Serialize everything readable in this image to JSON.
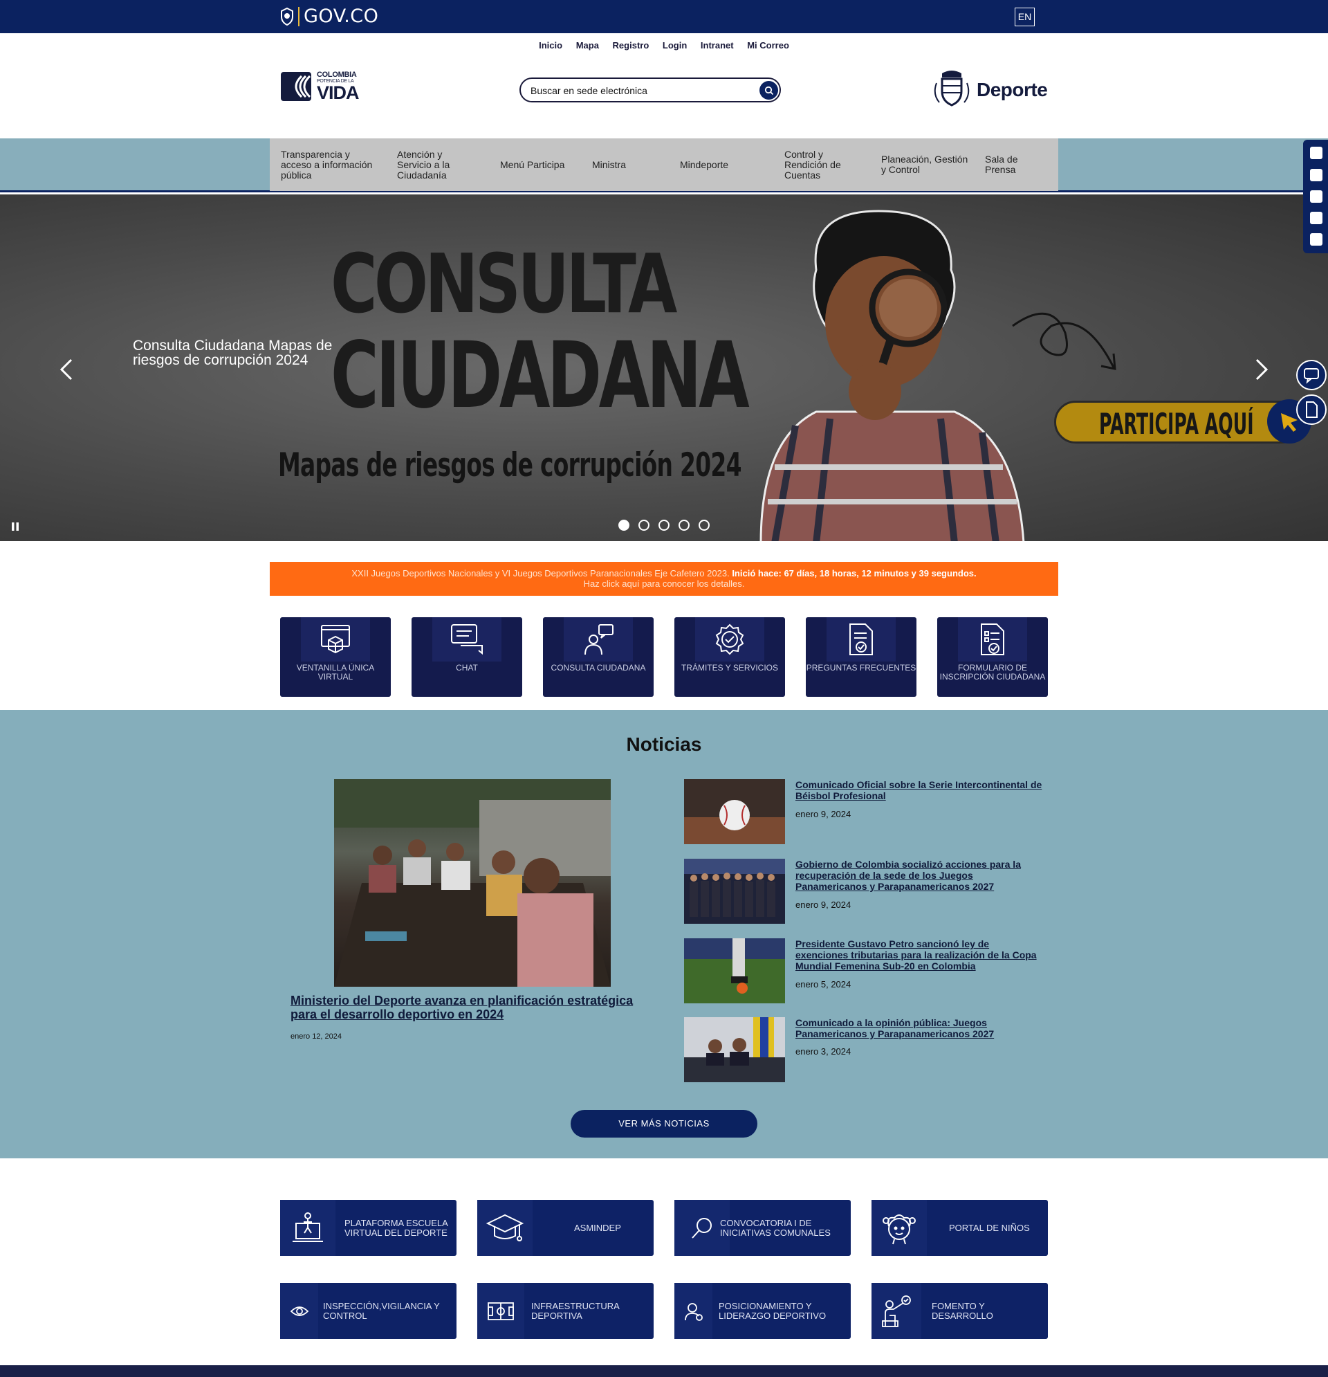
{
  "govbar": {
    "brand": "GOV.CO",
    "lang": "EN"
  },
  "utility_links": [
    "Inicio",
    "Mapa",
    "Registro",
    "Login",
    "Intranet",
    "Mi Correo"
  ],
  "header": {
    "logo": {
      "line1": "COLOMBIA",
      "line2": "POTENCIA DE LA",
      "line3": "VIDA"
    },
    "search_placeholder": "Buscar en sede electrónica",
    "ministry": "Deporte"
  },
  "nav": {
    "items": [
      "Transparencia y acceso a información pública",
      "Atención y Servicio a la Ciudadanía",
      "Menú Participa",
      "Ministra",
      "Mindeporte",
      "Control y Rendición de Cuentas",
      "Planeación, Gestión y Control",
      "Sala de Prensa"
    ]
  },
  "hero": {
    "caption": "Consulta Ciudadana Mapas de riesgos de corrupción 2024",
    "headline_1": "CONSULTA",
    "headline_2": "CIUDADANA",
    "subheadline": "Mapas de riesgos de corrupción 2024",
    "cta": "PARTICIPA AQUÍ",
    "slides_total": 5,
    "active_slide": 1
  },
  "banner": {
    "lead": "XXII Juegos Deportivos Nacionales y VI Juegos Deportivos Paranacionales Eje Cafetero 2023.",
    "countdown": "Inició hace: 67 días, 18 horas, 12 minutos y 39 segundos.",
    "line2": "Haz click aquí para conocer los detalles."
  },
  "quick_tiles": [
    {
      "label": "VENTANILLA ÚNICA VIRTUAL",
      "icon": "browser-box-icon"
    },
    {
      "label": "CHAT",
      "icon": "chat-icon"
    },
    {
      "label": "CONSULTA CIUDADANA",
      "icon": "person-chat-icon"
    },
    {
      "label": "TRÁMITES Y SERVICIOS",
      "icon": "badge-check-icon"
    },
    {
      "label": "PREGUNTAS FRECUENTES",
      "icon": "document-check-icon"
    },
    {
      "label": "FORMULARIO DE INSCRIPCIÓN CIUDADANA",
      "icon": "form-check-icon"
    }
  ],
  "news": {
    "heading": "Noticias",
    "featured": {
      "title": "Ministerio del Deporte avanza en planificación estratégica para el desarrollo deportivo en 2024",
      "date": "enero 12, 2024"
    },
    "items": [
      {
        "title": "Comunicado Oficial sobre la Serie Intercontinental de Béisbol Profesional",
        "date": "enero 9, 2024"
      },
      {
        "title": "Gobierno de Colombia socializó acciones para la recuperación de la sede de los Juegos Panamericanos y Parapanamericanos 2027",
        "date": "enero 9, 2024"
      },
      {
        "title": "Presidente Gustavo Petro sancionó ley de exenciones tributarias para la realización de la Copa Mundial Femenina Sub-20 en Colombia",
        "date": "enero 5, 2024"
      },
      {
        "title": "Comunicado a la opinión pública: Juegos Panamericanos y Parapanamericanos 2027",
        "date": "enero 3, 2024"
      }
    ],
    "more_button": "VER MÁS NOTICIAS"
  },
  "bottom_tiles": [
    {
      "label": "PLATAFORMA ESCUELA VIRTUAL DEL DEPORTE",
      "icon": "laptop-person-icon"
    },
    {
      "label": "ASMINDEP",
      "icon": "graduation-cap-icon"
    },
    {
      "label": "CONVOCATORIA I DE INICIATIVAS COMUNALES",
      "icon": "magnifier-icon"
    },
    {
      "label": "PORTAL DE NIÑOS",
      "icon": "child-face-icon"
    },
    {
      "label": "INSPECCIÓN,VIGILANCIA Y CONTROL",
      "icon": "eye-icon"
    },
    {
      "label": "INFRAESTRUCTURA DEPORTIVA",
      "icon": "field-icon"
    },
    {
      "label": "POSICIONAMIENTO Y LIDERAZGO DEPORTIVO",
      "icon": "person-award-icon"
    },
    {
      "label": "FOMENTO Y DESARROLLO",
      "icon": "coach-board-icon"
    }
  ]
}
